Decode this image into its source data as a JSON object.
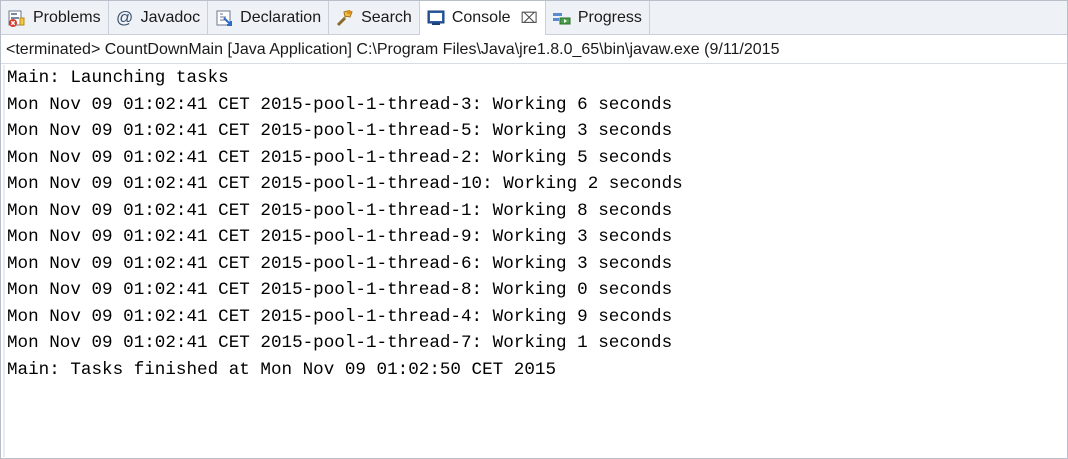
{
  "tabs": [
    {
      "label": "Problems",
      "icon": "problems-icon",
      "active": false
    },
    {
      "label": "Javadoc",
      "icon": "javadoc-icon",
      "active": false
    },
    {
      "label": "Declaration",
      "icon": "declaration-icon",
      "active": false
    },
    {
      "label": "Search",
      "icon": "search-icon",
      "active": false
    },
    {
      "label": "Console",
      "icon": "console-icon",
      "active": true,
      "close": "⌧"
    },
    {
      "label": "Progress",
      "icon": "progress-icon",
      "active": false
    }
  ],
  "status": "<terminated> CountDownMain [Java Application] C:\\Program Files\\Java\\jre1.8.0_65\\bin\\javaw.exe (9/11/2015",
  "console": {
    "lines": [
      "Main: Launching tasks",
      "Mon Nov 09 01:02:41 CET 2015-pool-1-thread-3: Working 6 seconds",
      "Mon Nov 09 01:02:41 CET 2015-pool-1-thread-5: Working 3 seconds",
      "Mon Nov 09 01:02:41 CET 2015-pool-1-thread-2: Working 5 seconds",
      "Mon Nov 09 01:02:41 CET 2015-pool-1-thread-10: Working 2 seconds",
      "Mon Nov 09 01:02:41 CET 2015-pool-1-thread-1: Working 8 seconds",
      "Mon Nov 09 01:02:41 CET 2015-pool-1-thread-9: Working 3 seconds",
      "Mon Nov 09 01:02:41 CET 2015-pool-1-thread-6: Working 3 seconds",
      "Mon Nov 09 01:02:41 CET 2015-pool-1-thread-8: Working 0 seconds",
      "Mon Nov 09 01:02:41 CET 2015-pool-1-thread-4: Working 9 seconds",
      "Mon Nov 09 01:02:41 CET 2015-pool-1-thread-7: Working 1 seconds",
      "Main: Tasks finished at Mon Nov 09 01:02:50 CET 2015"
    ]
  },
  "colors": {
    "tab_background": "#eef1f6",
    "active_tab": "#ffffff",
    "border": "#c9d0da",
    "text": "#000000"
  }
}
